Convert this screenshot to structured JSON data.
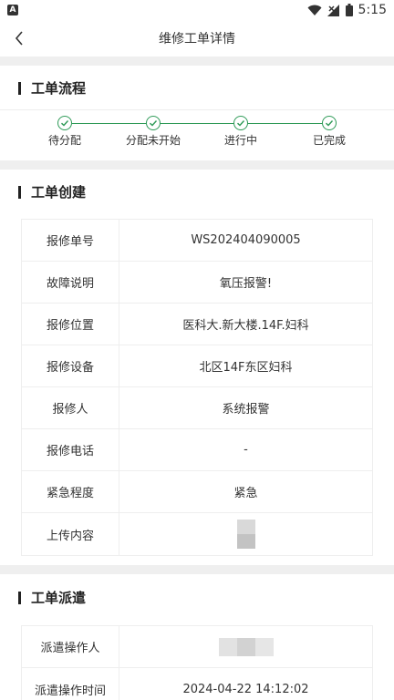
{
  "status_bar": {
    "time": "5:15",
    "app_badge": "A"
  },
  "header": {
    "title": "维修工单详情"
  },
  "flow": {
    "title": "工单流程",
    "steps": [
      {
        "label": "待分配"
      },
      {
        "label": "分配未开始"
      },
      {
        "label": "进行中"
      },
      {
        "label": "已完成"
      }
    ]
  },
  "creation": {
    "title": "工单创建",
    "rows": [
      {
        "key": "报修单号",
        "value": "WS202404090005"
      },
      {
        "key": "故障说明",
        "value": "氧压报警!"
      },
      {
        "key": "报修位置",
        "value": "医科大.新大楼.14F.妇科"
      },
      {
        "key": "报修设备",
        "value": "北区14F东区妇科"
      },
      {
        "key": "报修人",
        "value": "系统报警"
      },
      {
        "key": "报修电话",
        "value": "-"
      },
      {
        "key": "紧急程度",
        "value": "紧急"
      },
      {
        "key": "上传内容",
        "value": ""
      }
    ]
  },
  "dispatch": {
    "title": "工单派遣",
    "rows": [
      {
        "key": "派遣操作人",
        "value": ""
      },
      {
        "key": "派遣操作时间",
        "value": "2024-04-22 14:12:02"
      }
    ]
  },
  "colors": {
    "accent": "#2e9a57",
    "band": "#efefef"
  },
  "icons": {
    "back": "chevron-left-icon",
    "check": "check-circle-icon"
  }
}
